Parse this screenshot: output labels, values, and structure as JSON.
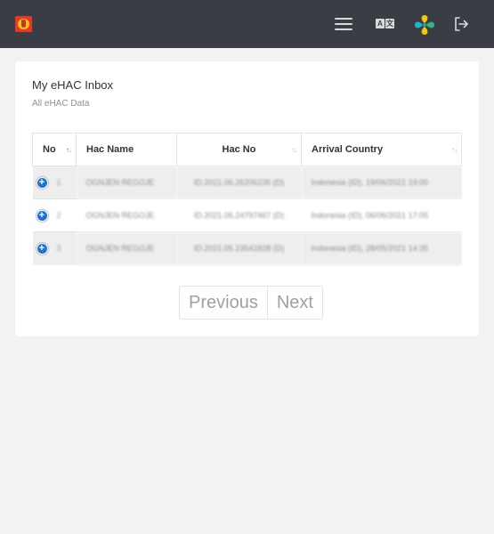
{
  "header": {
    "logo_icon": "ehac-logo-icon",
    "menu_icon": "hamburger-menu-icon",
    "language_icon": "language-translate-icon",
    "brand_icon": "pedulilindungi-logo-icon",
    "logout_icon": "logout-icon"
  },
  "inbox": {
    "title": "My eHAC Inbox",
    "subtitle": "All eHAC Data"
  },
  "table": {
    "columns": [
      "No",
      "Hac Name",
      "Hac No",
      "Arrival Country"
    ],
    "rows": [
      {
        "no": "1",
        "name": "OGNJEN REGOJE",
        "hac_no": "ID.2021.06.26206235 (D)",
        "arrival": "Indonesia (ID), 19/06/2021 19:00"
      },
      {
        "no": "2",
        "name": "OGNJEN REGOJE",
        "hac_no": "ID.2021.06.24797467 (D)",
        "arrival": "Indonesia (ID), 06/06/2021 17:05"
      },
      {
        "no": "3",
        "name": "OGNJEN REGOJE",
        "hac_no": "ID.2021.05.23541828 (D)",
        "arrival": "Indonesia (ID), 28/05/2021 14:35"
      }
    ]
  },
  "pagination": {
    "previous_label": "Previous",
    "next_label": "Next"
  },
  "colors": {
    "topbar": "#3a3d44",
    "accent": "#1a73d9",
    "page_background": "#f2f2f3"
  }
}
